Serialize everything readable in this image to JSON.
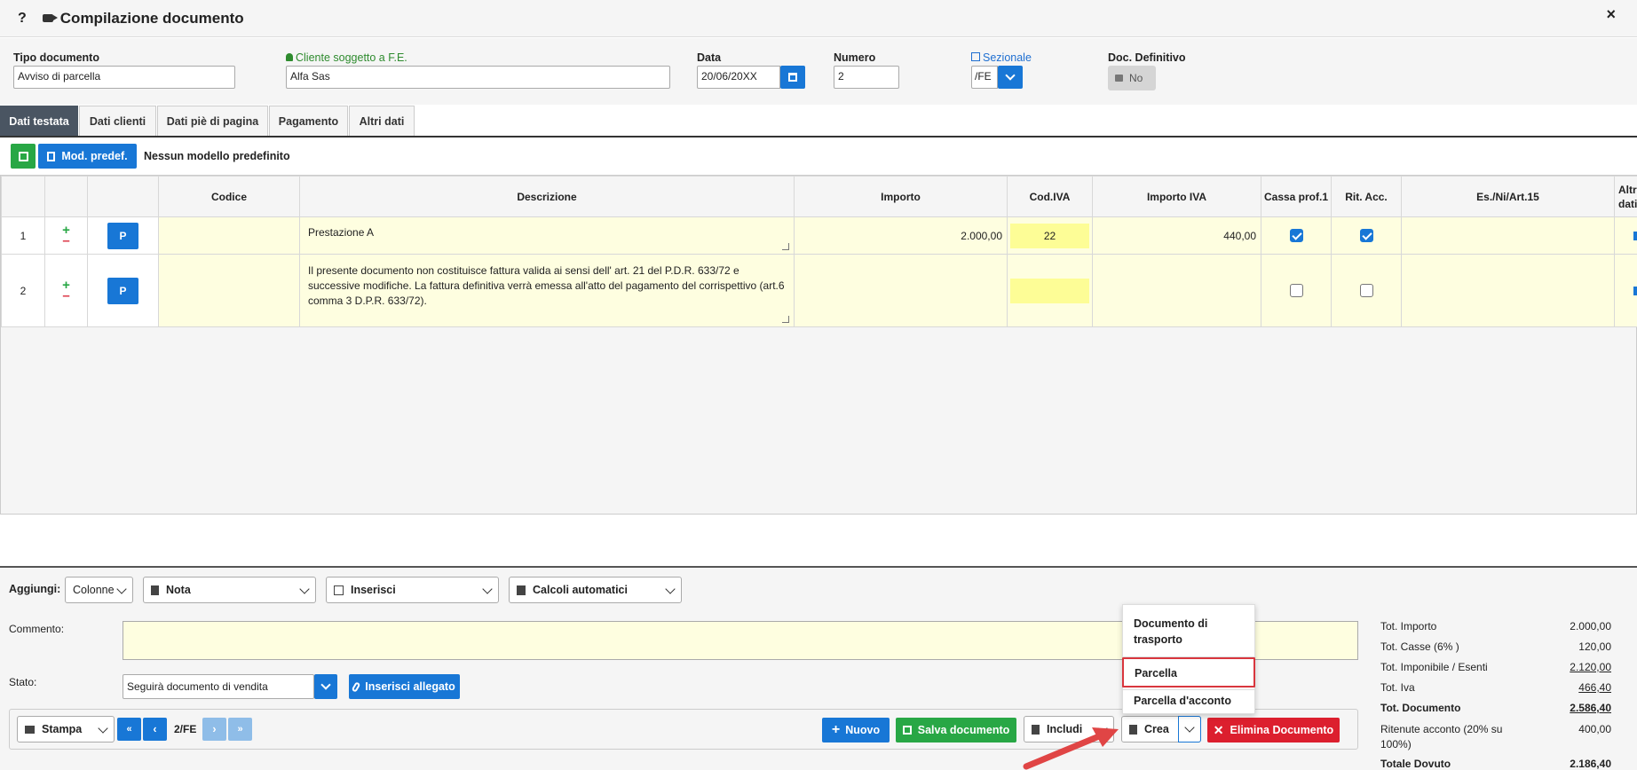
{
  "window": {
    "help": "?",
    "title": "Compilazione documento",
    "close": "×"
  },
  "header": {
    "tipo": {
      "label": "Tipo documento",
      "value": "Avviso di parcella"
    },
    "cliente": {
      "label": "Cliente soggetto a F.E.",
      "value": "Alfa Sas"
    },
    "data": {
      "label": "Data",
      "value": "20/06/20XX"
    },
    "numero": {
      "label": "Numero",
      "value": "2"
    },
    "sezionale": {
      "label": "Sezionale",
      "value": "/FE"
    },
    "definitivo": {
      "label": "Doc. Definitivo",
      "value": "No"
    }
  },
  "tabs": [
    {
      "label": "Dati testata",
      "active": true
    },
    {
      "label": "Dati clienti"
    },
    {
      "label": "Dati piè di pagina"
    },
    {
      "label": "Pagamento"
    },
    {
      "label": "Altri dati"
    }
  ],
  "toolbar": {
    "mod_label": "Mod. predef.",
    "note": "Nessun modello predefinito"
  },
  "grid": {
    "headers": [
      "Codice",
      "Descrizione",
      "Importo",
      "Cod.IVA",
      "Importo IVA",
      "Cassa prof.1",
      "Rit. Acc.",
      "Es./Ni/Art.15",
      "Altri dati"
    ],
    "p_label": "P",
    "rows": [
      {
        "n": "1",
        "descrizione": "Prestazione A",
        "importo": "2.000,00",
        "codiva": "22",
        "importo_iva": "440,00",
        "cassa": true,
        "rit": true
      },
      {
        "n": "2",
        "descrizione": "Il presente documento non costituisce fattura valida ai sensi dell' art. 21 del P.D.R. 633/72 e successive modifiche. La fattura definitiva verrà emessa all'atto del pagamento del corrispettivo (art.6 comma 3 D.P.R. 633/72).",
        "importo": "",
        "codiva": "",
        "importo_iva": "",
        "cassa": false,
        "rit": false
      }
    ]
  },
  "bottom": {
    "aggiungi_label": "Aggiungi:",
    "colonne": "Colonne",
    "nota": "Nota",
    "inserisci": "Inserisci",
    "calcoli": "Calcoli automatici",
    "commento_label": "Commento:",
    "stato_label": "Stato:",
    "stato_value": "Seguirà documento di vendita",
    "allegato": "Inserisci allegato",
    "stampa": "Stampa",
    "page": "2/FE",
    "nuovo": "Nuovo",
    "salva": "Salva documento",
    "includi": "Includi",
    "crea": "Crea",
    "elimina": "Elimina Documento"
  },
  "dropdown": {
    "items": [
      "Documento di trasporto",
      "Parcella",
      "Parcella d'acconto"
    ],
    "highlight": "Parcella"
  },
  "totals": [
    {
      "k": "Tot. Importo",
      "v": "2.000,00"
    },
    {
      "k": "Tot. Casse (6% )",
      "v": "120,00"
    },
    {
      "k": "Tot. Imponibile / Esenti",
      "v": "2.120,00"
    },
    {
      "k": "Tot. Iva",
      "v": "466,40"
    },
    {
      "k": "Tot. Documento",
      "v": "2.586,40"
    },
    {
      "k": "Ritenute acconto (20% su 100%)",
      "v": "400,00"
    },
    {
      "k": "Totale Dovuto",
      "v": "2.186,40"
    }
  ]
}
